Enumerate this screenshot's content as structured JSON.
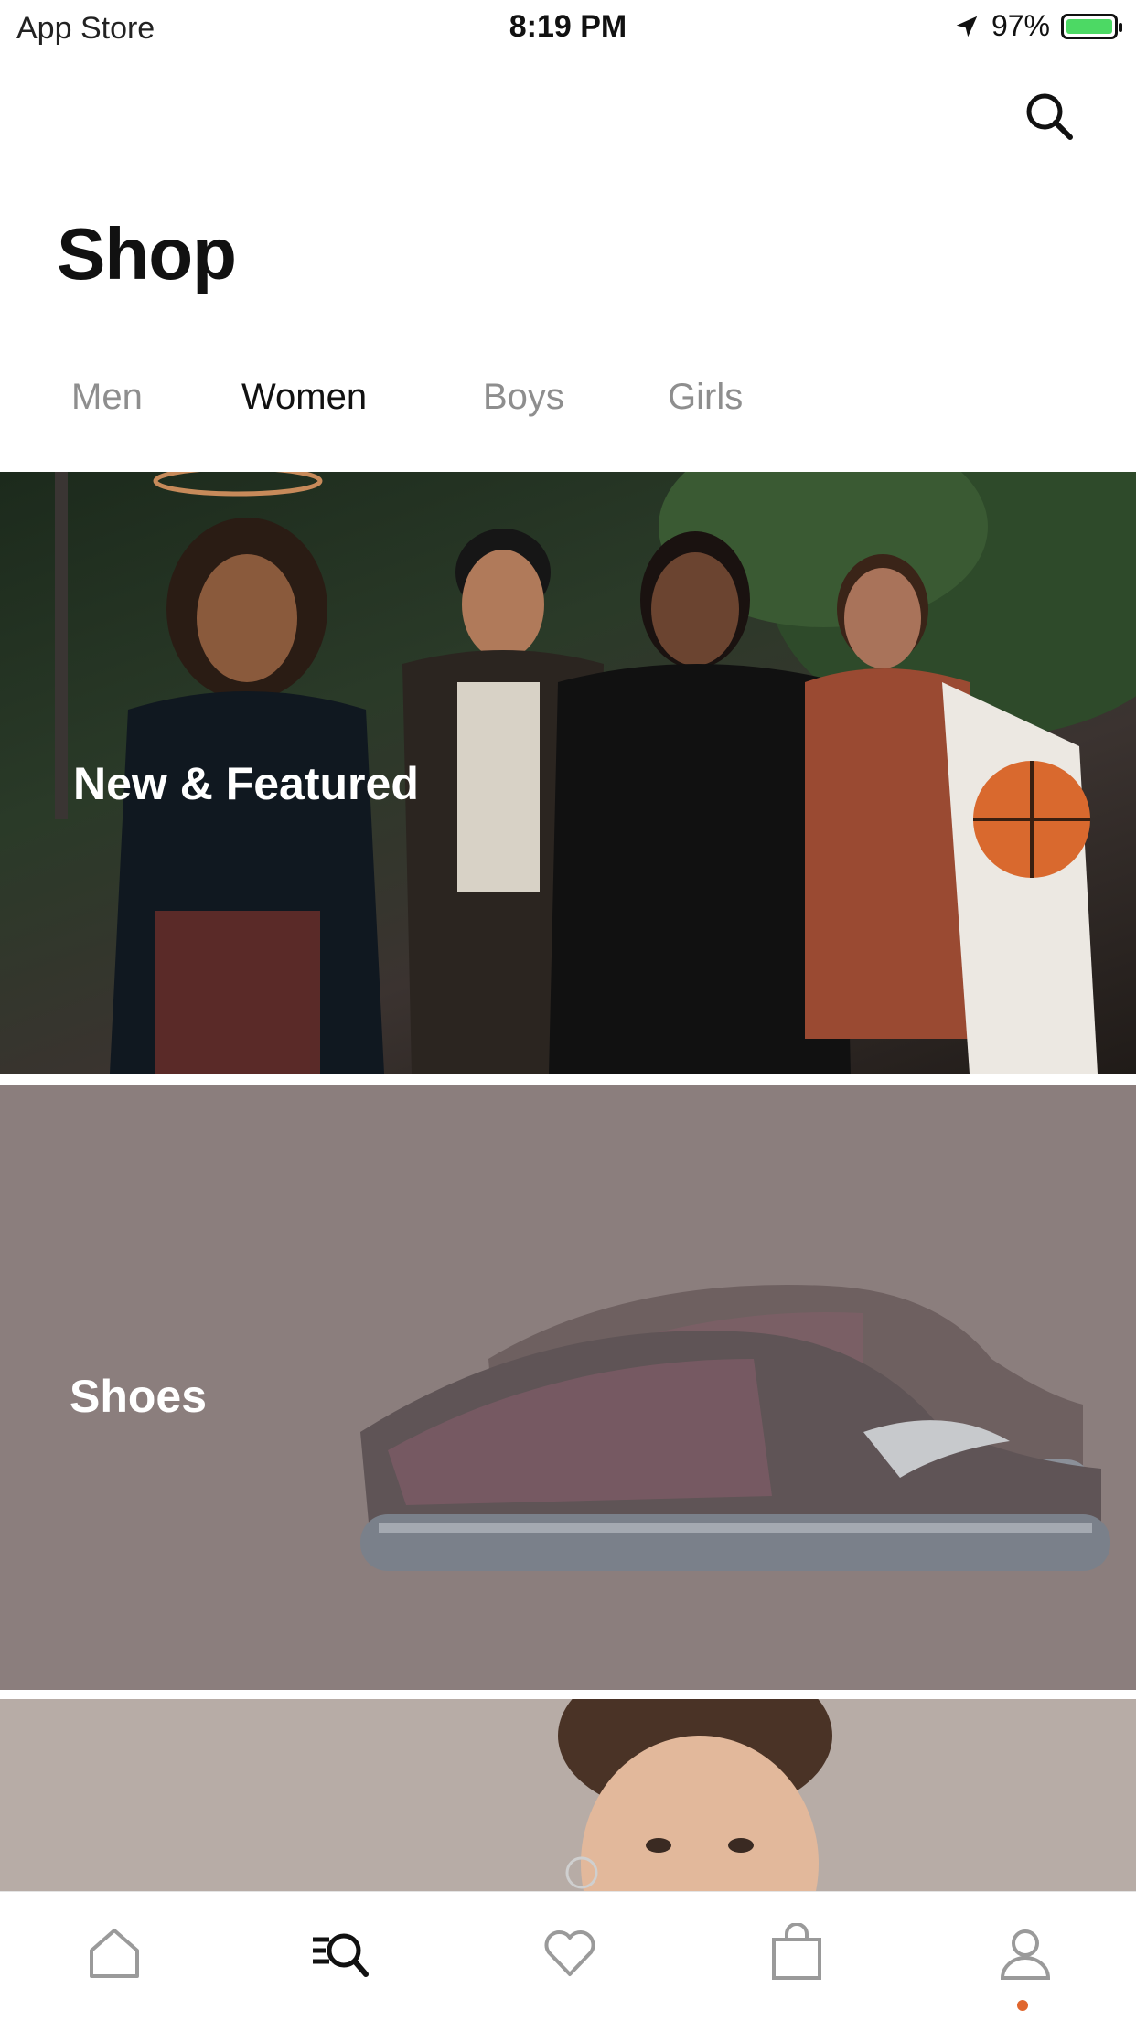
{
  "status_bar": {
    "carrier": "App Store",
    "time": "8:19 PM",
    "battery": "97%"
  },
  "header": {
    "title": "Shop",
    "search_icon": "search-icon"
  },
  "tabs": [
    {
      "label": "Men",
      "active": false
    },
    {
      "label": "Women",
      "active": true
    },
    {
      "label": "Boys",
      "active": false
    },
    {
      "label": "Girls",
      "active": false
    }
  ],
  "cards": [
    {
      "label": "New & Featured"
    },
    {
      "label": "Shoes"
    },
    {
      "label": ""
    }
  ],
  "bottom_nav": [
    {
      "icon": "home-icon"
    },
    {
      "icon": "shop-search-icon"
    },
    {
      "icon": "heart-icon"
    },
    {
      "icon": "bag-icon"
    },
    {
      "icon": "profile-icon"
    }
  ],
  "colors": {
    "accent_dot": "#e0662e",
    "tab_active": "#111111",
    "tab_inactive": "#8e8e8e"
  }
}
